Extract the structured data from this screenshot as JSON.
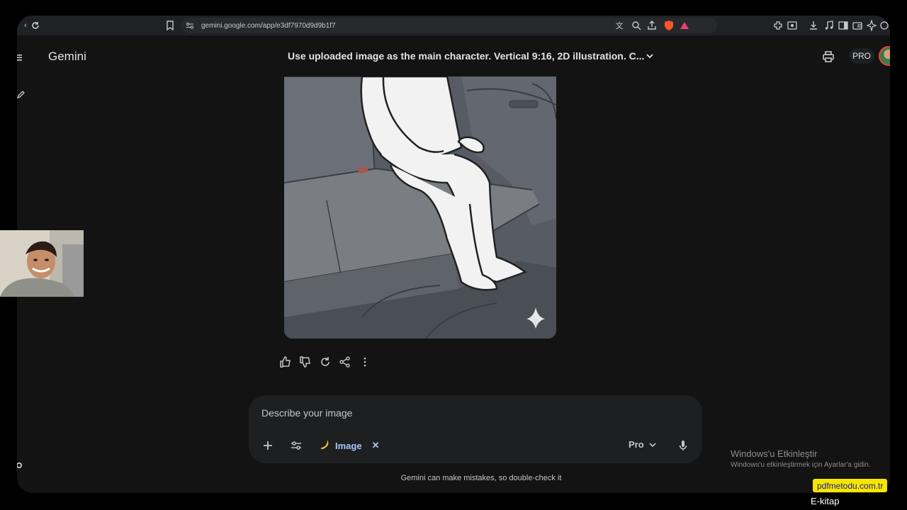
{
  "browser": {
    "url": "gemini.google.com/app/e3df7970d9d9b1f7"
  },
  "app": {
    "brand": "Gemini",
    "conversation_title": "Use uploaded image as the main character.   Vertical 9:16, 2D illustration.   C...",
    "pro_chip": "PRO"
  },
  "composer": {
    "placeholder": "Describe your image",
    "image_chip": "Image",
    "model": "Pro"
  },
  "disclaimer": "Gemini can make mistakes, so double-check it",
  "overlays": {
    "windows_title": "Windows'u Etkinleştir",
    "windows_sub": "Windows'u etkinleştirmek için Ayarlar'a gidin.",
    "site_badge": "pdfmetodu.com.tr",
    "ekitap": "E-kitap"
  },
  "icons": {
    "response_actions": [
      "thumbs-up-icon",
      "thumbs-down-icon",
      "regenerate-icon",
      "share-icon",
      "more-icon"
    ]
  }
}
